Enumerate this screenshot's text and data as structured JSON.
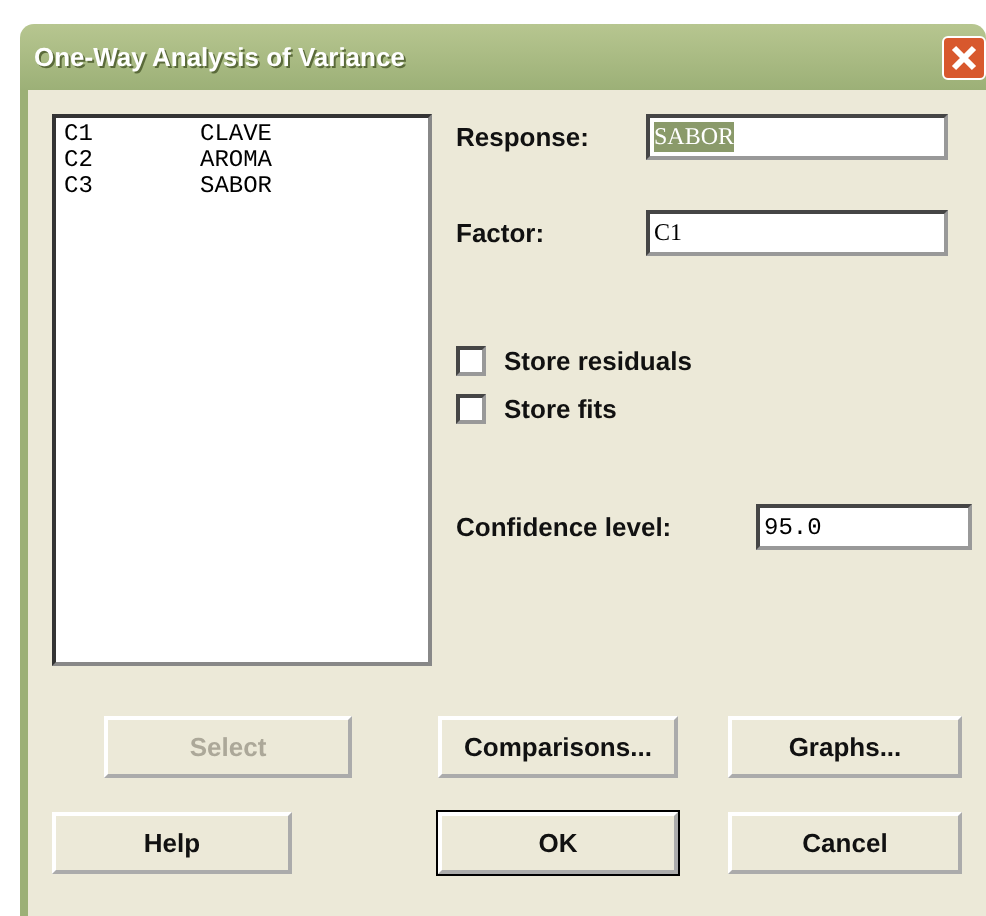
{
  "window": {
    "title": "One-Way Analysis of Variance"
  },
  "variables": [
    {
      "column": "C1",
      "name": "CLAVE"
    },
    {
      "column": "C2",
      "name": "AROMA"
    },
    {
      "column": "C3",
      "name": "SABOR"
    }
  ],
  "response": {
    "label": "Response:",
    "value": "SABOR",
    "selected": true
  },
  "factor": {
    "label": "Factor:",
    "value": "C1",
    "selected": false
  },
  "options": [
    {
      "label": "Store residuals",
      "checked": false
    },
    {
      "label": "Store fits",
      "checked": false
    }
  ],
  "confidence": {
    "label": "Confidence level:",
    "value": "95.0"
  },
  "buttons": [
    {
      "label": "Select",
      "disabled": true,
      "default": false
    },
    {
      "label": "Comparisons...",
      "disabled": false,
      "default": false
    },
    {
      "label": "Graphs...",
      "disabled": false,
      "default": false
    },
    {
      "label": "Help",
      "disabled": false,
      "default": false
    },
    {
      "label": "OK",
      "disabled": false,
      "default": true
    },
    {
      "label": "Cancel",
      "disabled": false,
      "default": false
    }
  ]
}
